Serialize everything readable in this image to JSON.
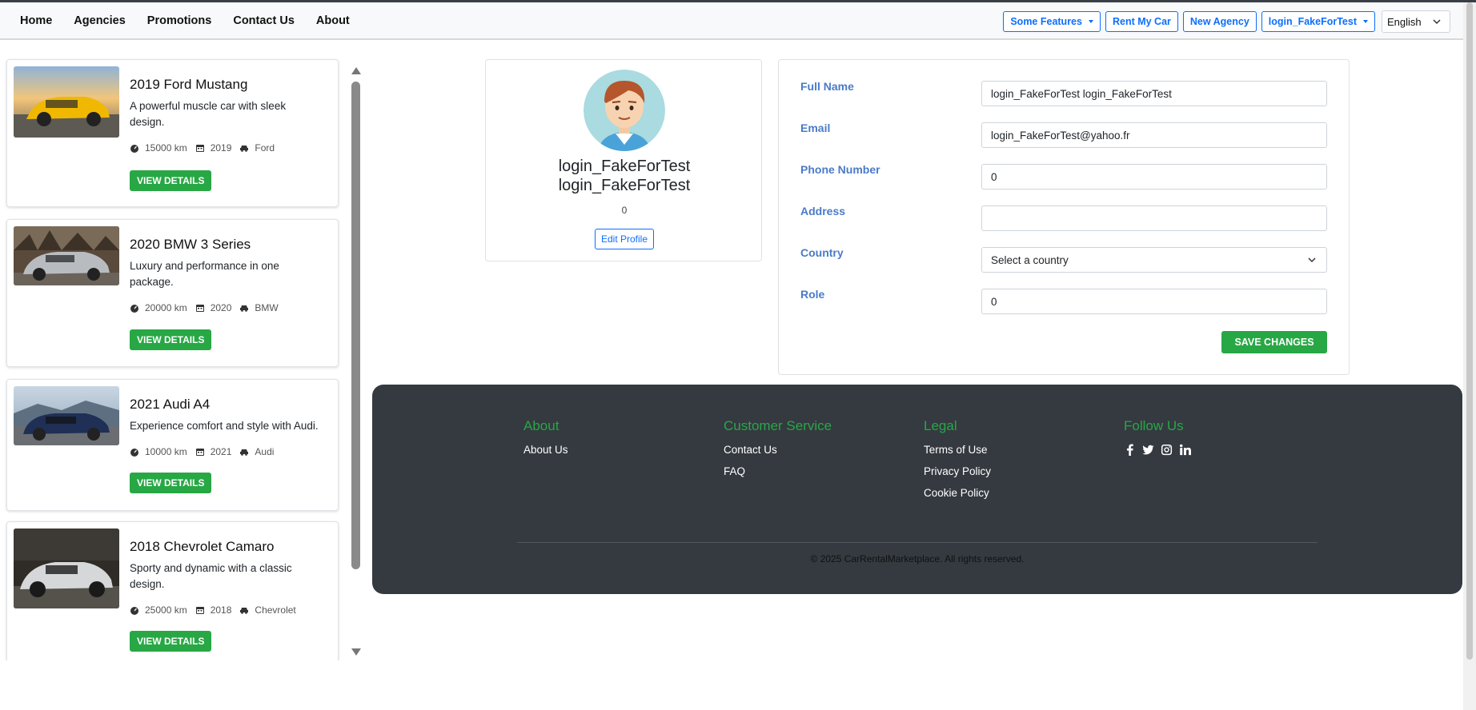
{
  "nav": {
    "links": [
      "Home",
      "Agencies",
      "Promotions",
      "Contact Us",
      "About"
    ],
    "features_label": "Some Features",
    "rent_label": "Rent My Car",
    "agency_label": "New Agency",
    "user_label": "login_FakeForTest",
    "language": "English"
  },
  "cars": [
    {
      "title": "2019 Ford Mustang",
      "description": "A powerful muscle car with sleek design.",
      "mileage": "15000 km",
      "year": "2019",
      "make": "Ford",
      "button": "VIEW DETAILS"
    },
    {
      "title": "2020 BMW 3 Series",
      "description": "Luxury and performance in one package.",
      "mileage": "20000 km",
      "year": "2020",
      "make": "BMW",
      "button": "VIEW DETAILS"
    },
    {
      "title": "2021 Audi A4",
      "description": "Experience comfort and style with Audi.",
      "mileage": "10000 km",
      "year": "2021",
      "make": "Audi",
      "button": "VIEW DETAILS"
    },
    {
      "title": "2018 Chevrolet Camaro",
      "description": "Sporty and dynamic with a classic design.",
      "mileage": "25000 km",
      "year": "2018",
      "make": "Chevrolet",
      "button": "VIEW DETAILS"
    }
  ],
  "profile": {
    "first_name": "login_FakeForTest",
    "last_name": "login_FakeForTest",
    "count": "0",
    "edit_label": "Edit Profile"
  },
  "form": {
    "full_name_label": "Full Name",
    "full_name_value": "login_FakeForTest login_FakeForTest",
    "email_label": "Email",
    "email_value": "login_FakeForTest@yahoo.fr",
    "phone_label": "Phone Number",
    "phone_value": "0",
    "address_label": "Address",
    "address_value": "",
    "country_label": "Country",
    "country_value": "Select a country",
    "role_label": "Role",
    "role_value": "0",
    "save_label": "SAVE CHANGES"
  },
  "footer": {
    "about_heading": "About",
    "about_links": [
      "About Us"
    ],
    "service_heading": "Customer Service",
    "service_links": [
      "Contact Us",
      "FAQ"
    ],
    "legal_heading": "Legal",
    "legal_links": [
      "Terms of Use",
      "Privacy Policy",
      "Cookie Policy"
    ],
    "follow_heading": "Follow Us",
    "social_icons": [
      "facebook-icon",
      "twitter-icon",
      "instagram-icon",
      "linkedin-icon"
    ],
    "copyright": "© 2025 CarRentalMarketplace. All rights reserved."
  },
  "colors": {
    "accent_blue": "#0d6efd",
    "success_green": "#28a745",
    "label_blue": "#4a7bc8",
    "footer_bg": "#343a40"
  }
}
